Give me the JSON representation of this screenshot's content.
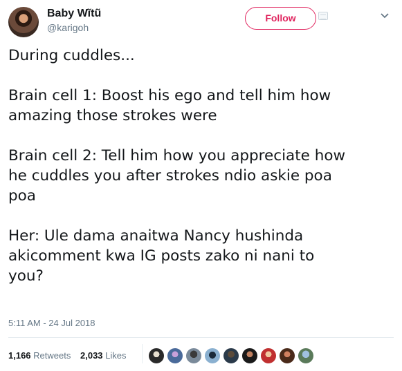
{
  "user": {
    "display_name": "Baby Wĩtũ",
    "handle": "@karigoh"
  },
  "follow_button_label": "Follow",
  "tweet": {
    "text": "During cuddles...\n\nBrain cell 1: Boost his ego and tell him how\namazing those strokes were\n\nBrain cell 2: Tell him how you appreciate how\nhe cuddles you after strokes ndio askie poa\npoa\n\nHer: Ule dama anaitwa Nancy hushinda\nakicomment kwa IG posts zako ni nani to\nyou?",
    "timestamp": "5:11 AM - 24 Jul 2018"
  },
  "stats": {
    "retweets_count": "1,166",
    "retweets_label": "Retweets",
    "likes_count": "2,033",
    "likes_label": "Likes"
  },
  "icons": {
    "menu": "chevron-down-icon",
    "follow_extra": "card-icon"
  },
  "colors": {
    "follow_accent": "#e0245e",
    "secondary_text": "#657786"
  }
}
